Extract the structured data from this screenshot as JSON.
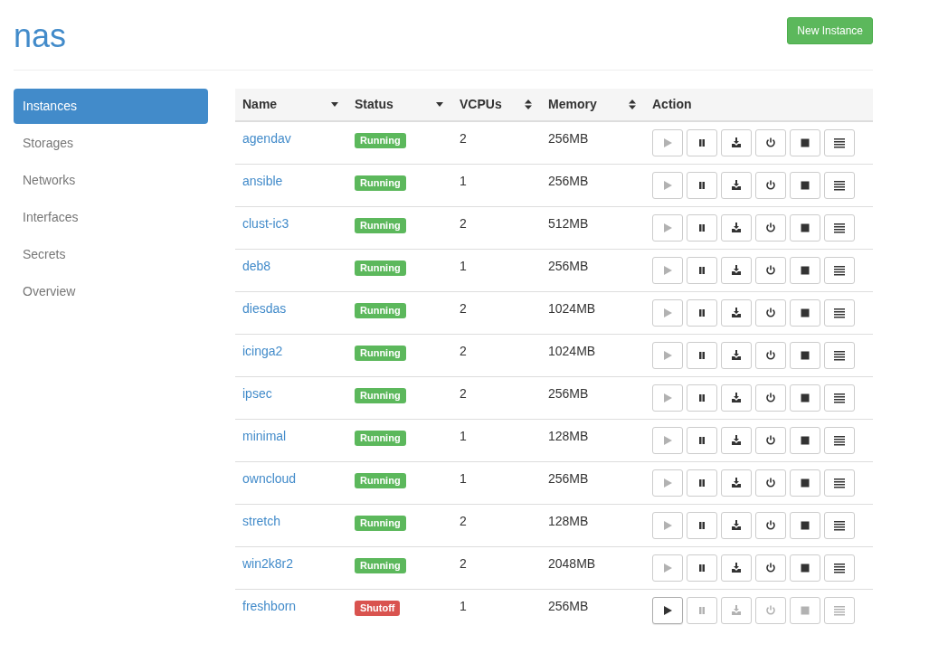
{
  "header": {
    "title": "nas",
    "new_button": "New Instance"
  },
  "sidebar": {
    "items": [
      {
        "label": "Instances",
        "selected": true
      },
      {
        "label": "Storages",
        "selected": false
      },
      {
        "label": "Networks",
        "selected": false
      },
      {
        "label": "Interfaces",
        "selected": false
      },
      {
        "label": "Secrets",
        "selected": false
      },
      {
        "label": "Overview",
        "selected": false
      }
    ]
  },
  "table": {
    "columns": [
      {
        "label": "Name",
        "kind": "desc"
      },
      {
        "label": "Status",
        "kind": "desc"
      },
      {
        "label": "VCPUs",
        "kind": "both"
      },
      {
        "label": "Memory",
        "kind": "both"
      },
      {
        "label": "Action"
      }
    ],
    "rows": [
      {
        "name": "agendav",
        "status": "Running",
        "kind": "running",
        "vcpus": "2",
        "memory": "256MB"
      },
      {
        "name": "ansible",
        "status": "Running",
        "kind": "running",
        "vcpus": "1",
        "memory": "256MB"
      },
      {
        "name": "clust-ic3",
        "status": "Running",
        "kind": "running",
        "vcpus": "2",
        "memory": "512MB"
      },
      {
        "name": "deb8",
        "status": "Running",
        "kind": "running",
        "vcpus": "1",
        "memory": "256MB"
      },
      {
        "name": "diesdas",
        "status": "Running",
        "kind": "running",
        "vcpus": "2",
        "memory": "1024MB"
      },
      {
        "name": "icinga2",
        "status": "Running",
        "kind": "running",
        "vcpus": "2",
        "memory": "1024MB"
      },
      {
        "name": "ipsec",
        "status": "Running",
        "kind": "running",
        "vcpus": "2",
        "memory": "256MB"
      },
      {
        "name": "minimal",
        "status": "Running",
        "kind": "running",
        "vcpus": "1",
        "memory": "128MB"
      },
      {
        "name": "owncloud",
        "status": "Running",
        "kind": "running",
        "vcpus": "1",
        "memory": "256MB"
      },
      {
        "name": "stretch",
        "status": "Running",
        "kind": "running",
        "vcpus": "2",
        "memory": "128MB"
      },
      {
        "name": "win2k8r2",
        "status": "Running",
        "kind": "running",
        "vcpus": "2",
        "memory": "2048MB"
      },
      {
        "name": "freshborn",
        "status": "Shutoff",
        "kind": "shutoff",
        "vcpus": "1",
        "memory": "256MB"
      }
    ]
  }
}
